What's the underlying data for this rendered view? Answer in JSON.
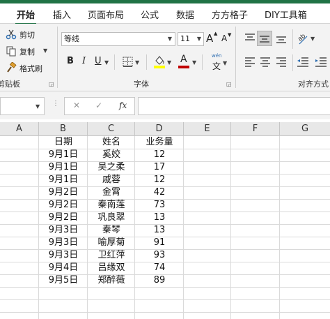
{
  "tabs": [
    "开始",
    "插入",
    "页面布局",
    "公式",
    "数据",
    "方方格子",
    "DIY工具箱"
  ],
  "clipboard": {
    "cut": "剪切",
    "copy": "复制",
    "format_painter": "格式刷",
    "group_label": "剪贴板"
  },
  "font": {
    "name": "等线",
    "size": "11",
    "bold": "B",
    "italic": "I",
    "underline": "U",
    "grow": "A",
    "shrink": "A",
    "wen_top": "wén",
    "wen_bottom": "文",
    "font_color_glyph": "A",
    "group_label": "字体"
  },
  "alignment": {
    "group_label": "对齐方式"
  },
  "formula_bar": {
    "cancel": "✕",
    "enter": "✓",
    "fx": "fx",
    "value": ""
  },
  "columns": [
    "A",
    "B",
    "C",
    "D",
    "E",
    "F",
    "G"
  ],
  "table": {
    "headers": [
      "日期",
      "姓名",
      "业务量"
    ],
    "rows": [
      [
        "9月1日",
        "奚姣",
        "12"
      ],
      [
        "9月1日",
        "吴之柔",
        "17"
      ],
      [
        "9月1日",
        "戚蓉",
        "12"
      ],
      [
        "9月2日",
        "金霄",
        "42"
      ],
      [
        "9月2日",
        "秦南莲",
        "73"
      ],
      [
        "9月2日",
        "巩良翠",
        "13"
      ],
      [
        "9月3日",
        "秦琴",
        "13"
      ],
      [
        "9月3日",
        "喻厚菊",
        "91"
      ],
      [
        "9月3日",
        "卫红萍",
        "93"
      ],
      [
        "9月4日",
        "吕缘双",
        "74"
      ],
      [
        "9月5日",
        "郑醉薇",
        "89"
      ]
    ]
  },
  "colors": {
    "accent": "#217346",
    "highlight": "#ffff00",
    "font_color": "#c00000"
  }
}
